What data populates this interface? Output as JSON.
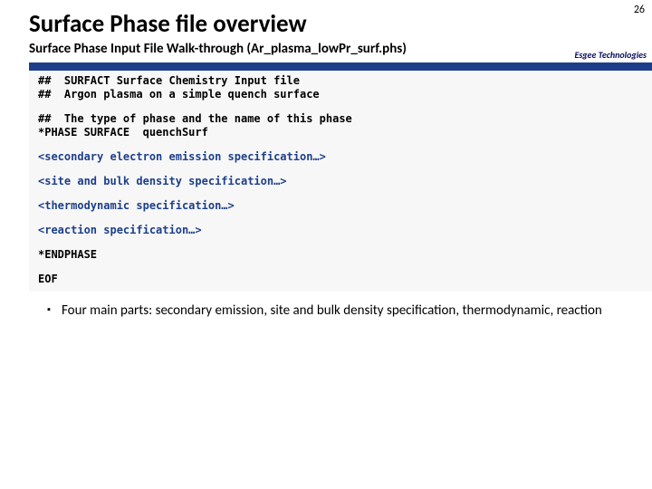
{
  "page_number": "26",
  "title": "Surface Phase file overview",
  "subtitle": "Surface Phase Input File Walk-through (Ar_plasma_lowPr_surf.phs)",
  "brand": "Esgee Technologies",
  "code": {
    "l1": "##  SURFACT Surface Chemistry Input file",
    "l2": "##  Argon plasma on a simple quench surface",
    "l3": "##  The type of phase and the name of this phase",
    "l4": "*PHASE SURFACE  quenchSurf",
    "a1": "<secondary electron emission specification…>",
    "a2": "<site and bulk density specification…>",
    "a3": "<thermodynamic specification…>",
    "a4": "<reaction specification…>",
    "l5": "*ENDPHASE",
    "l6": "EOF"
  },
  "bullets": {
    "b1": "Four main parts: secondary emission, site and bulk density specification, thermodynamic, reaction"
  }
}
